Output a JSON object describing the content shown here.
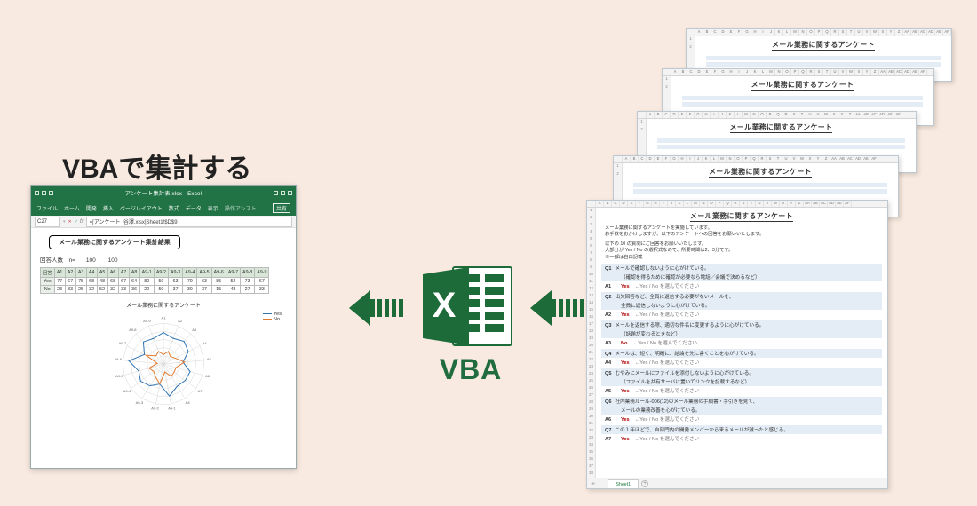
{
  "heading": "VBAで集計する",
  "center": {
    "vba_label": "VBA"
  },
  "result_wb": {
    "titlebar": "アンケート集計表.xlsx - Excel",
    "tabs": [
      "ファイル",
      "ホーム",
      "開発",
      "挿入",
      "ページレイアウト",
      "数式",
      "データ",
      "表示"
    ],
    "assist": "操作アシスト…",
    "share": "共有",
    "name_box": "C27",
    "fx": "=[アンケート_谷澤.xlsx]Sheet1!$D$9",
    "result_title": "メール業務に関するアンケート集計結果",
    "resp_label": "回答人数　n=",
    "resp_value": "100",
    "table": {
      "headers": [
        "回答",
        "A1",
        "A2",
        "A3",
        "A4",
        "A5",
        "A6",
        "A7",
        "A8",
        "A9-1",
        "A9-2",
        "A9-3",
        "A9-4",
        "A9-5",
        "A9-6",
        "A9-7",
        "A9-8",
        "A9-9"
      ],
      "rows": [
        [
          "Yes",
          "77",
          "67",
          "75",
          "68",
          "48",
          "68",
          "67",
          "64",
          "80",
          "50",
          "63",
          "70",
          "63",
          "85",
          "52",
          "73",
          "67"
        ],
        [
          "No",
          "23",
          "33",
          "25",
          "32",
          "52",
          "32",
          "33",
          "36",
          "20",
          "50",
          "37",
          "30",
          "37",
          "15",
          "48",
          "27",
          "33"
        ]
      ]
    },
    "radar_title": "メール業務に関するアンケート",
    "radar_legend": [
      "Yes",
      "No"
    ]
  },
  "chart_data": {
    "type": "radar",
    "categories": [
      "A1",
      "A2",
      "A3",
      "A4",
      "A5",
      "A6",
      "A7",
      "A8",
      "A9-1",
      "A9-2",
      "A9-3",
      "A9-4",
      "A9-5",
      "A9-6",
      "A9-7",
      "A9-8",
      "A9-9"
    ],
    "series": [
      {
        "name": "Yes",
        "color": "#2e74b5",
        "values": [
          77,
          67,
          75,
          68,
          48,
          68,
          67,
          64,
          80,
          50,
          63,
          70,
          63,
          85,
          52,
          73,
          67
        ]
      },
      {
        "name": "No",
        "color": "#e07a2f",
        "values": [
          23,
          33,
          25,
          32,
          52,
          32,
          33,
          36,
          20,
          50,
          37,
          30,
          37,
          15,
          48,
          27,
          33
        ]
      }
    ],
    "rmax": 100,
    "title": "メール業務に関するアンケート"
  },
  "survey": {
    "title": "メール業務に関するアンケート",
    "columns": [
      "A",
      "B",
      "C",
      "D",
      "E",
      "F",
      "G",
      "H",
      "I",
      "J",
      "K",
      "L",
      "M",
      "N",
      "O",
      "P",
      "Q",
      "R",
      "S",
      "T",
      "U",
      "V",
      "W",
      "X",
      "Y",
      "Z",
      "AA",
      "AB",
      "AC",
      "AD",
      "AE",
      "AF"
    ],
    "intro": [
      "メール業務に関するアンケートを実施しています。",
      "お手数をおかけしますが、以下のアンケートへの回答をお願いいたします。",
      "",
      "以下の 10 の質問にご回答をお願いいたします。",
      "大部分が Yes / No の選択式なので、所要時間は2、3分です。",
      "※一部は自由記載"
    ],
    "qa": [
      {
        "q_num": "Q1",
        "q": "メールで確認しないように心がけている。",
        "q2": "（確認を得るために確認が必要なら電話／会議で決めるなど）",
        "a_num": "A1",
        "a": "Yes"
      },
      {
        "q_num": "Q2",
        "q": "出欠回答など、全員に返信する必要がないメールを、",
        "q2": "全員に返信しないように心がけている。",
        "a_num": "A2",
        "a": "Yes"
      },
      {
        "q_num": "Q3",
        "q": "メールを返信する際、適切な件名に変更するように心がけている。",
        "q2": "（話題が変わるときなど）",
        "a_num": "A3",
        "a": "No"
      },
      {
        "q_num": "Q4",
        "q": "メールは、短く、明確に、結論を先に書くことを心がけている。",
        "q2": "",
        "a_num": "A4",
        "a": "Yes"
      },
      {
        "q_num": "Q5",
        "q": "むやみにメールにファイルを添付しないように心がけている。",
        "q2": "（ファイルを共有サーバに置いてリンクを記載するなど）",
        "a_num": "A5",
        "a": "Yes"
      },
      {
        "q_num": "Q6",
        "q": "社内業務ルール-006(12)のメール業務の手順書・手引きを見て、",
        "q2": "メールの業務改善を心がけている。",
        "a_num": "A6",
        "a": "Yes"
      },
      {
        "q_num": "Q7",
        "q": "この１年ほどで、自部門内の開発メンバーから来るメールが減ったと感じる。",
        "q2": "",
        "a_num": "A7",
        "a": "Yes"
      }
    ],
    "answer_note": "←Yes / No を選んでください",
    "sheet_tab": "Sheet1"
  }
}
